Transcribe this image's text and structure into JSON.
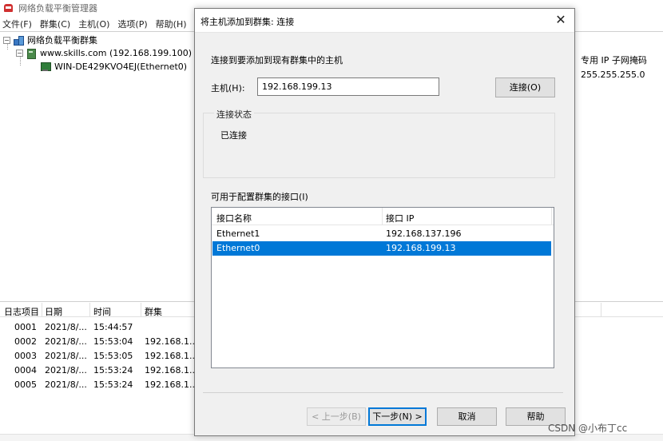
{
  "main": {
    "title": "网络负载平衡管理器",
    "menu": [
      "文件(F)",
      "群集(C)",
      "主机(O)",
      "选项(P)",
      "帮助(H)"
    ],
    "tree": {
      "root": "网络负载平衡群集",
      "cluster": "www.skills.com (192.168.199.100)",
      "host": "WIN-DE429KVO4EJ(Ethernet0)"
    },
    "right_panel": {
      "header": "专用 IP 子网掩码",
      "value": "255.255.255.0"
    },
    "log": {
      "columns": [
        "日志项目",
        "日期",
        "时间",
        "群集"
      ],
      "rows": [
        [
          "0001",
          "2021/8/...",
          "15:44:57",
          ""
        ],
        [
          "0002",
          "2021/8/...",
          "15:53:04",
          "192.168.1..."
        ],
        [
          "0003",
          "2021/8/...",
          "15:53:05",
          "192.168.1..."
        ],
        [
          "0004",
          "2021/8/...",
          "15:53:24",
          "192.168.1..."
        ],
        [
          "0005",
          "2021/8/...",
          "15:53:24",
          "192.168.1..."
        ]
      ]
    }
  },
  "dialog": {
    "title": "将主机添加到群集: 连接",
    "close_glyph": "✕",
    "instruction": "连接到要添加到现有群集中的主机",
    "host_label": "主机(H):",
    "host_value": "192.168.199.13",
    "connect_label": "连接(O)",
    "status_group": "连接状态",
    "status_text": "已连接",
    "interfaces_label": "可用于配置群集的接口(I)",
    "columns": [
      "接口名称",
      "接口 IP"
    ],
    "interfaces": [
      {
        "name": "Ethernet1",
        "ip": "192.168.137.196"
      },
      {
        "name": "Ethernet0",
        "ip": "192.168.199.13"
      }
    ],
    "selected_index": 1,
    "buttons": {
      "back": "< 上一步(B)",
      "next": "下一步(N) >",
      "cancel": "取消",
      "help": "帮助"
    }
  },
  "watermark": "CSDN @小布丁cc",
  "colors": {
    "selection": "#0078d7",
    "dialog_bg": "#f0f0f0"
  }
}
